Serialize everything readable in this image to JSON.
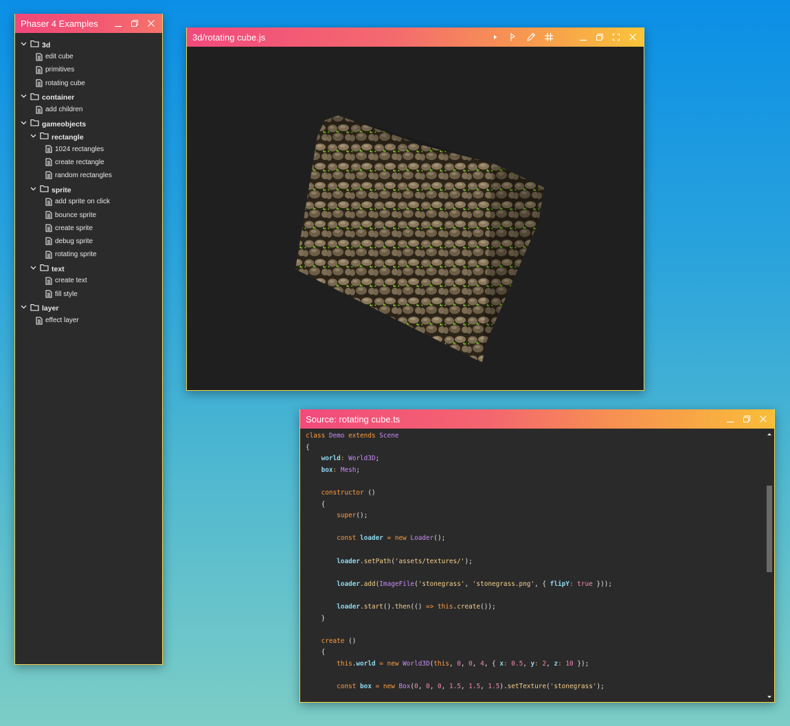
{
  "examples_window": {
    "title": "Phaser 4 Examples",
    "tree": [
      {
        "type": "folder",
        "label": "3d",
        "depth": 0
      },
      {
        "type": "file",
        "label": "edit cube",
        "depth": 0
      },
      {
        "type": "file",
        "label": "primitives",
        "depth": 0
      },
      {
        "type": "file",
        "label": "rotating cube",
        "depth": 0
      },
      {
        "type": "folder",
        "label": "container",
        "depth": 0
      },
      {
        "type": "file",
        "label": "add children",
        "depth": 0
      },
      {
        "type": "folder",
        "label": "gameobjects",
        "depth": 0
      },
      {
        "type": "folder",
        "label": "rectangle",
        "depth": 1
      },
      {
        "type": "file",
        "label": "1024 rectangles",
        "depth": 1
      },
      {
        "type": "file",
        "label": "create rectangle",
        "depth": 1
      },
      {
        "type": "file",
        "label": "random rectangles",
        "depth": 1
      },
      {
        "type": "folder",
        "label": "sprite",
        "depth": 1
      },
      {
        "type": "file",
        "label": "add sprite on click",
        "depth": 1
      },
      {
        "type": "file",
        "label": "bounce sprite",
        "depth": 1
      },
      {
        "type": "file",
        "label": "create sprite",
        "depth": 1
      },
      {
        "type": "file",
        "label": "debug sprite",
        "depth": 1
      },
      {
        "type": "file",
        "label": "rotating sprite",
        "depth": 1
      },
      {
        "type": "folder",
        "label": "text",
        "depth": 1
      },
      {
        "type": "file",
        "label": "create text",
        "depth": 1
      },
      {
        "type": "file",
        "label": "fill style",
        "depth": 1
      },
      {
        "type": "folder",
        "label": "layer",
        "depth": 0
      },
      {
        "type": "file",
        "label": "effect layer",
        "depth": 0
      }
    ]
  },
  "preview_window": {
    "title": "3d/rotating cube.js",
    "tools": [
      "play-icon",
      "step-icon",
      "pencil-icon",
      "grid-icon"
    ]
  },
  "source_window": {
    "title": "Source: rotating cube.ts",
    "code": [
      [
        [
          "kw",
          "class "
        ],
        [
          "cls",
          "Demo "
        ],
        [
          "kw",
          "extends "
        ],
        [
          "cls",
          "Scene"
        ]
      ],
      [
        [
          "t",
          "{"
        ]
      ],
      [
        [
          "t",
          "    "
        ],
        [
          "prop",
          "world"
        ],
        [
          "kw",
          ": "
        ],
        [
          "cls",
          "World3D"
        ],
        [
          "t",
          ";"
        ]
      ],
      [
        [
          "t",
          "    "
        ],
        [
          "prop",
          "box"
        ],
        [
          "kw",
          ": "
        ],
        [
          "cls",
          "Mesh"
        ],
        [
          "t",
          ";"
        ]
      ],
      [],
      [
        [
          "t",
          "    "
        ],
        [
          "kw",
          "constructor "
        ],
        [
          "t",
          "()"
        ]
      ],
      [
        [
          "t",
          "    {"
        ]
      ],
      [
        [
          "t",
          "        "
        ],
        [
          "kw",
          "super"
        ],
        [
          "t",
          "();"
        ]
      ],
      [],
      [
        [
          "t",
          "        "
        ],
        [
          "kw",
          "const "
        ],
        [
          "prop",
          "loader"
        ],
        [
          "kw",
          " = new "
        ],
        [
          "cls",
          "Loader"
        ],
        [
          "t",
          "();"
        ]
      ],
      [],
      [
        [
          "t",
          "        "
        ],
        [
          "prop",
          "loader"
        ],
        [
          "t",
          "."
        ],
        [
          "fn",
          "setPath"
        ],
        [
          "t",
          "("
        ],
        [
          "str",
          "'assets/textures/'"
        ],
        [
          "t",
          ");"
        ]
      ],
      [],
      [
        [
          "t",
          "        "
        ],
        [
          "prop",
          "loader"
        ],
        [
          "t",
          "."
        ],
        [
          "fn",
          "add"
        ],
        [
          "t",
          "("
        ],
        [
          "cls",
          "ImageFile"
        ],
        [
          "t",
          "("
        ],
        [
          "str",
          "'stonegrass'"
        ],
        [
          "t",
          ", "
        ],
        [
          "str",
          "'stonegrass.png'"
        ],
        [
          "t",
          ", { "
        ],
        [
          "prop",
          "flipY"
        ],
        [
          "kw",
          ": "
        ],
        [
          "num",
          "true"
        ],
        [
          "t",
          " }));"
        ]
      ],
      [],
      [
        [
          "t",
          "        "
        ],
        [
          "prop",
          "loader"
        ],
        [
          "t",
          "."
        ],
        [
          "fn",
          "start"
        ],
        [
          "t",
          "()."
        ],
        [
          "fn",
          "then"
        ],
        [
          "t",
          "(() "
        ],
        [
          "kw",
          "=> this"
        ],
        [
          "t",
          "."
        ],
        [
          "fn",
          "create"
        ],
        [
          "t",
          "());"
        ]
      ],
      [
        [
          "t",
          "    }"
        ]
      ],
      [],
      [
        [
          "t",
          "    "
        ],
        [
          "kw",
          "create "
        ],
        [
          "t",
          "()"
        ]
      ],
      [
        [
          "t",
          "    {"
        ]
      ],
      [
        [
          "t",
          "        "
        ],
        [
          "kw",
          "this"
        ],
        [
          "t",
          "."
        ],
        [
          "prop",
          "world"
        ],
        [
          "kw",
          " = new "
        ],
        [
          "cls",
          "World3D"
        ],
        [
          "t",
          "("
        ],
        [
          "kw",
          "this"
        ],
        [
          "t",
          ", "
        ],
        [
          "num",
          "0"
        ],
        [
          "t",
          ", "
        ],
        [
          "num",
          "0"
        ],
        [
          "t",
          ", "
        ],
        [
          "num",
          "4"
        ],
        [
          "t",
          ", { "
        ],
        [
          "prop",
          "x"
        ],
        [
          "kw",
          ": "
        ],
        [
          "num",
          "0.5"
        ],
        [
          "t",
          ", "
        ],
        [
          "prop",
          "y"
        ],
        [
          "kw",
          ": "
        ],
        [
          "num",
          "2"
        ],
        [
          "t",
          ", "
        ],
        [
          "prop",
          "z"
        ],
        [
          "kw",
          ": "
        ],
        [
          "num",
          "10"
        ],
        [
          "t",
          " });"
        ]
      ],
      [],
      [
        [
          "t",
          "        "
        ],
        [
          "kw",
          "const "
        ],
        [
          "prop",
          "box"
        ],
        [
          "kw",
          " = new "
        ],
        [
          "cls",
          "Box"
        ],
        [
          "t",
          "("
        ],
        [
          "num",
          "0"
        ],
        [
          "t",
          ", "
        ],
        [
          "num",
          "0"
        ],
        [
          "t",
          ", "
        ],
        [
          "num",
          "0"
        ],
        [
          "t",
          ", "
        ],
        [
          "num",
          "1.5"
        ],
        [
          "t",
          ", "
        ],
        [
          "num",
          "1.5"
        ],
        [
          "t",
          ", "
        ],
        [
          "num",
          "1.5"
        ],
        [
          "t",
          ")."
        ],
        [
          "fn",
          "setTexture"
        ],
        [
          "t",
          "("
        ],
        [
          "str",
          "'stonegrass'"
        ],
        [
          "t",
          ");"
        ]
      ]
    ]
  },
  "colors": {
    "background_top": "#0b8fe6",
    "background_bottom": "#7ccdc6",
    "border": "#f9d54a",
    "title_gradient_start": "#f0487a",
    "title_gradient_end": "#f9c43a",
    "window_bg": "#2b2b2b"
  }
}
